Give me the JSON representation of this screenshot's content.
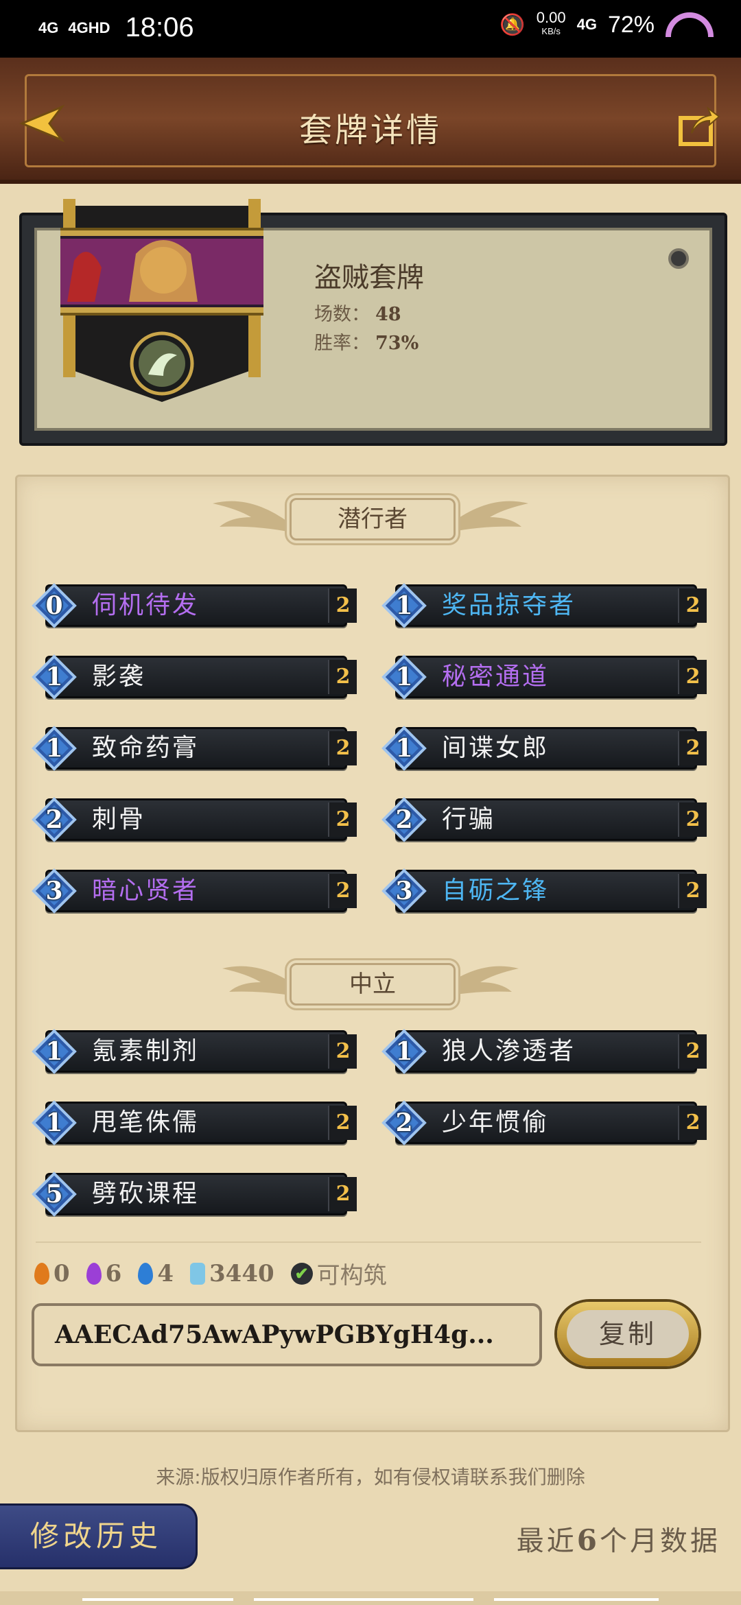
{
  "status_bar": {
    "signal1": "4G",
    "signal2": "4GHD",
    "time": "18:06",
    "speed_value": "0.00",
    "speed_unit": "KB/s",
    "net": "4G",
    "battery": "72%"
  },
  "header": {
    "title": "套牌详情"
  },
  "deck": {
    "name": "盗贼套牌",
    "games_label": "场数：",
    "games": "48",
    "winrate_label": "胜率：",
    "winrate": "73%"
  },
  "sections": [
    {
      "title": "潜行者",
      "cards": [
        {
          "cost": "0",
          "name": "伺机待发",
          "count": "2",
          "color": "#b46ef0"
        },
        {
          "cost": "1",
          "name": "奖品掠夺者",
          "count": "2",
          "color": "#4eb6f2"
        },
        {
          "cost": "1",
          "name": "影袭",
          "count": "2",
          "color": "#f2f2f2"
        },
        {
          "cost": "1",
          "name": "秘密通道",
          "count": "2",
          "color": "#b46ef0"
        },
        {
          "cost": "1",
          "name": "致命药膏",
          "count": "2",
          "color": "#f2f2f2"
        },
        {
          "cost": "1",
          "name": "间谍女郎",
          "count": "2",
          "color": "#f2f2f2"
        },
        {
          "cost": "2",
          "name": "刺骨",
          "count": "2",
          "color": "#f2f2f2"
        },
        {
          "cost": "2",
          "name": "行骗",
          "count": "2",
          "color": "#f2f2f2"
        },
        {
          "cost": "3",
          "name": "暗心贤者",
          "count": "2",
          "color": "#b46ef0"
        },
        {
          "cost": "3",
          "name": "自砺之锋",
          "count": "2",
          "color": "#4eb6f2"
        }
      ]
    },
    {
      "title": "中立",
      "cards": [
        {
          "cost": "1",
          "name": "氪素制剂",
          "count": "2",
          "color": "#f2f2f2"
        },
        {
          "cost": "1",
          "name": "狼人渗透者",
          "count": "2",
          "color": "#f2f2f2"
        },
        {
          "cost": "1",
          "name": "甩笔侏儒",
          "count": "2",
          "color": "#f2f2f2"
        },
        {
          "cost": "2",
          "name": "少年惯偷",
          "count": "2",
          "color": "#f2f2f2"
        },
        {
          "cost": "5",
          "name": "劈砍课程",
          "count": "2",
          "color": "#f2f2f2"
        }
      ]
    }
  ],
  "costs": {
    "orange": "0",
    "purple": "6",
    "blue": "4",
    "dust": "3440",
    "buildable": "可构筑"
  },
  "deck_code": "AAECAd75AwAPywPGBYgH4g...",
  "copy_label": "复制",
  "source_text": "来源:版权归原作者所有，如有侵权请联系我们删除",
  "history_label": "修改历史",
  "recent_prefix": "最近",
  "recent_number": "6",
  "recent_suffix": "个月数据"
}
